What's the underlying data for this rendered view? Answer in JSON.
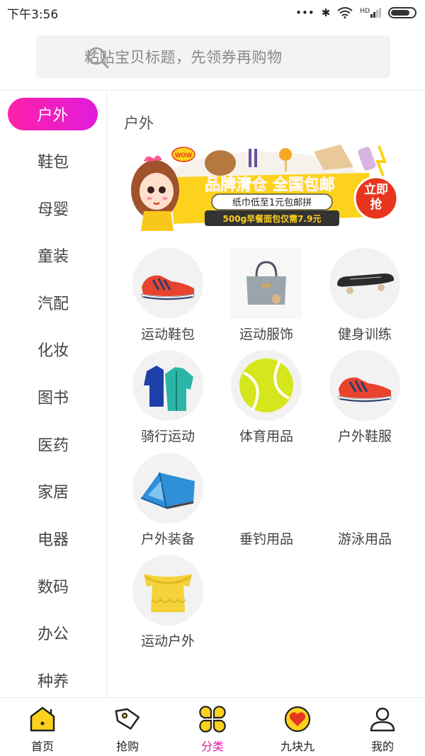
{
  "status_bar": {
    "time": "下午3:56",
    "dots": "•••",
    "bluetooth": "✱",
    "hd": "HD"
  },
  "search": {
    "placeholder": "粘贴宝贝标题，先领券再购物",
    "icon": "search-icon"
  },
  "sidebar": {
    "items": [
      {
        "label": "户外",
        "active": true
      },
      {
        "label": "鞋包"
      },
      {
        "label": "母婴"
      },
      {
        "label": "童装"
      },
      {
        "label": "汽配"
      },
      {
        "label": "化妆"
      },
      {
        "label": "图书"
      },
      {
        "label": "医药"
      },
      {
        "label": "家居"
      },
      {
        "label": "电器"
      },
      {
        "label": "数码"
      },
      {
        "label": "办公"
      },
      {
        "label": "种养"
      }
    ]
  },
  "content": {
    "title": "户外",
    "banner": {
      "headline": "品牌清仓 全国包邮",
      "line1": "纸巾低至1元包邮拼",
      "line2": "500g早餐面包仅需7.9元",
      "cta": "立即抢",
      "badge": "WOW"
    },
    "categories": [
      {
        "label": "运动鞋包",
        "icon": "sneaker-icon"
      },
      {
        "label": "运动服饰",
        "icon": "handbag-icon"
      },
      {
        "label": "健身训练",
        "icon": "skateboard-icon"
      },
      {
        "label": "骑行运动",
        "icon": "jacket-icon"
      },
      {
        "label": "体育用品",
        "icon": "tennis-ball-icon"
      },
      {
        "label": "户外鞋服",
        "icon": "sneaker-icon"
      },
      {
        "label": "户外装备",
        "icon": "tent-icon"
      },
      {
        "label": "垂钓用品",
        "icon": ""
      },
      {
        "label": "游泳用品",
        "icon": ""
      },
      {
        "label": "运动户外",
        "icon": "shirt-icon"
      }
    ]
  },
  "tabbar": {
    "tabs": [
      {
        "label": "首页",
        "icon": "home-icon"
      },
      {
        "label": "抢购",
        "icon": "tag-icon"
      },
      {
        "label": "分类",
        "icon": "category-icon",
        "active": true
      },
      {
        "label": "九块九",
        "icon": "heart-badge-icon"
      },
      {
        "label": "我的",
        "icon": "user-icon"
      }
    ]
  },
  "colors": {
    "accent": "#e0199d",
    "accent_gradient_end": "#e01cdc"
  }
}
